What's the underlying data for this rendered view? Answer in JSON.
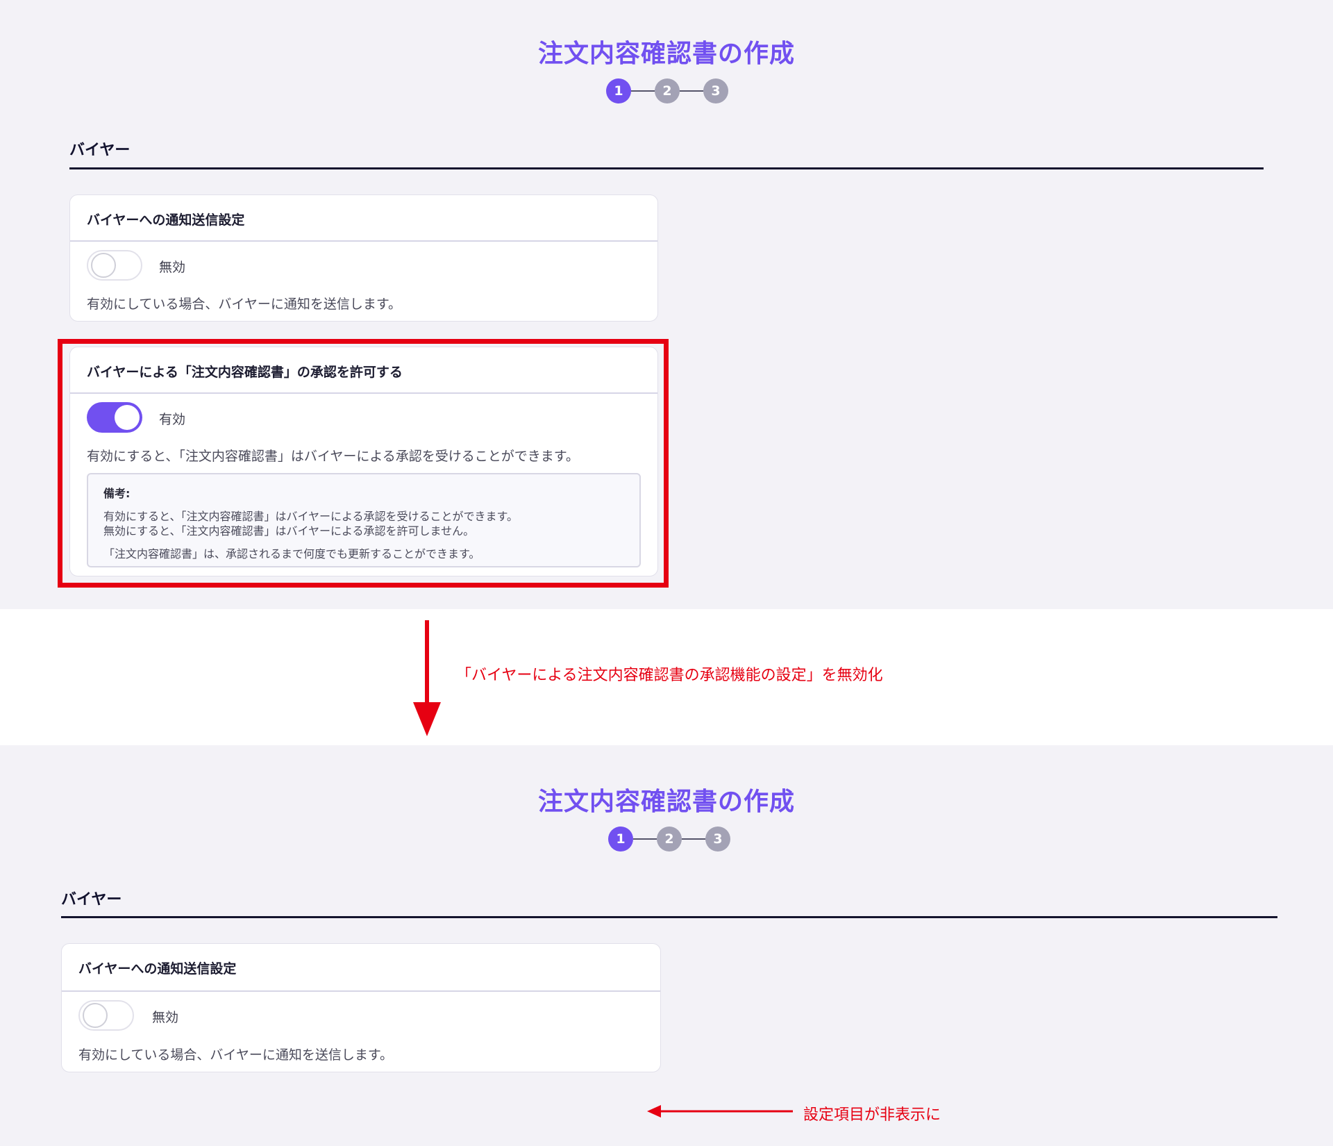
{
  "before": {
    "page_title": "注文内容確認書の作成",
    "steps": [
      "1",
      "2",
      "3"
    ],
    "section_label": "バイヤー",
    "notify_card": {
      "title": "バイヤーへの通知送信設定",
      "toggle_state": "無効",
      "description": "有効にしている場合、バイヤーに通知を送信します。"
    },
    "approval_card": {
      "title": "バイヤーによる「注文内容確認書」の承認を許可する",
      "toggle_state": "有効",
      "description": "有効にすると、「注文内容確認書」はバイヤーによる承認を受けることができます。",
      "note_title": "備考:",
      "note_lines": [
        "有効にすると、「注文内容確認書」はバイヤーによる承認を受けることができます。",
        "無効にすると、「注文内容確認書」はバイヤーによる承認を許可しません。",
        "「注文内容確認書」は、承認されるまで何度でも更新することができます。"
      ]
    }
  },
  "transition_annotation": "「バイヤーによる注文内容確認書の承認機能の設定」を無効化",
  "after": {
    "page_title": "注文内容確認書の作成",
    "steps": [
      "1",
      "2",
      "3"
    ],
    "section_label": "バイヤー",
    "notify_card": {
      "title": "バイヤーへの通知送信設定",
      "toggle_state": "無効",
      "description": "有効にしている場合、バイヤーに通知を送信します。"
    },
    "hidden_annotation": "設定項目が非表示に"
  },
  "colors": {
    "accent": "#7150f0",
    "step_inactive": "#a3a2b5",
    "annotation_red": "#e60012",
    "panel_bg": "#f3f2f7"
  }
}
